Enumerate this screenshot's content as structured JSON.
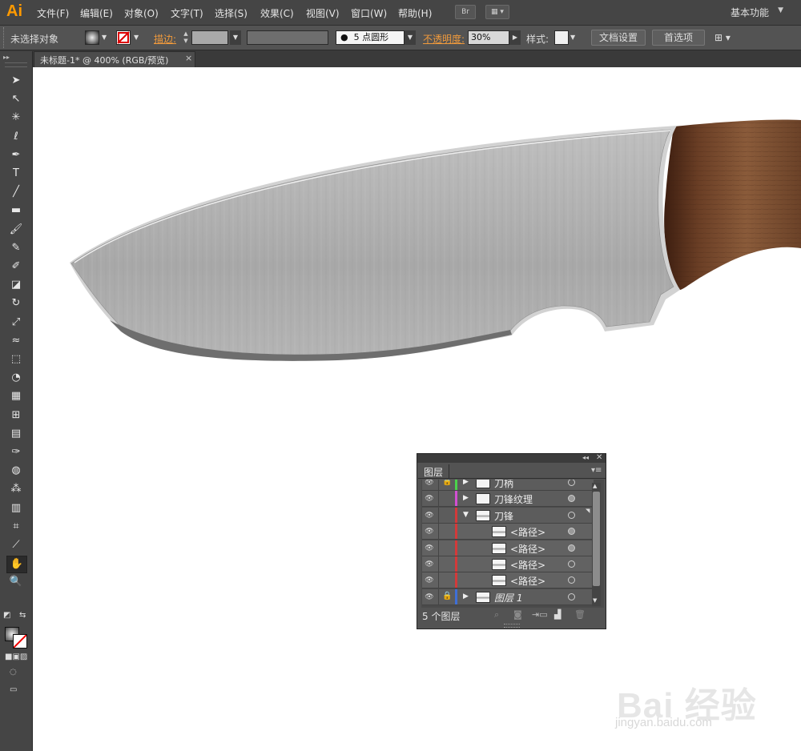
{
  "app": {
    "logo": "Ai"
  },
  "menu": {
    "items": [
      "文件(F)",
      "编辑(E)",
      "对象(O)",
      "文字(T)",
      "选择(S)",
      "效果(C)",
      "视图(V)",
      "窗口(W)",
      "帮助(H)"
    ],
    "bridge_label": "Br",
    "workspace": "基本功能"
  },
  "control": {
    "selection": "未选择对象",
    "stroke_label": "描边:",
    "brush_value": "5 点圆形",
    "opacity_label": "不透明度:",
    "opacity_value": "30%",
    "style_label": "样式:",
    "doc_setup": "文档设置",
    "preferences": "首选项"
  },
  "tab": {
    "title": "未标题-1* @ 400% (RGB/预览)",
    "close": "×"
  },
  "toolbar": {
    "tools": [
      "selection-tool",
      "direct-selection-tool",
      "magic-wand-tool",
      "lasso-tool",
      "pen-tool",
      "type-tool",
      "line-tool",
      "rectangle-tool",
      "paintbrush-tool",
      "pencil-tool",
      "blob-brush-tool",
      "eraser-tool",
      "rotate-tool",
      "scale-tool",
      "warp-tool",
      "free-transform-tool",
      "shape-builder-tool",
      "perspective-grid-tool",
      "mesh-tool",
      "gradient-tool",
      "eyedropper-tool",
      "blend-tool",
      "symbol-sprayer-tool",
      "column-graph-tool",
      "artboard-tool",
      "slice-tool",
      "hand-tool",
      "zoom-tool"
    ]
  },
  "layers": {
    "panel_title": "图层",
    "footer": "5 个图层",
    "rows": [
      {
        "name": "刀柄",
        "color": "#4bd34b",
        "expand": "▶",
        "locked": true,
        "target": "empty",
        "italic": false,
        "level": 0
      },
      {
        "name": "刀锋纹理",
        "color": "#d24fd2",
        "expand": "▶",
        "locked": false,
        "target": "filled",
        "italic": false,
        "level": 0
      },
      {
        "name": "刀锋",
        "color": "#d23a3a",
        "expand": "▼",
        "locked": false,
        "target": "empty",
        "italic": false,
        "level": 0
      },
      {
        "name": "<路径>",
        "color": "#d23a3a",
        "expand": "",
        "locked": false,
        "target": "filled",
        "italic": false,
        "level": 1
      },
      {
        "name": "<路径>",
        "color": "#d23a3a",
        "expand": "",
        "locked": false,
        "target": "filled",
        "italic": false,
        "level": 1
      },
      {
        "name": "<路径>",
        "color": "#d23a3a",
        "expand": "",
        "locked": false,
        "target": "empty",
        "italic": false,
        "level": 1
      },
      {
        "name": "<路径>",
        "color": "#d23a3a",
        "expand": "",
        "locked": false,
        "target": "empty",
        "italic": false,
        "level": 1
      },
      {
        "name": "图层 1",
        "color": "#3f6fd6",
        "expand": "▶",
        "locked": true,
        "target": "empty",
        "italic": true,
        "level": 0
      }
    ]
  },
  "watermark": {
    "brand": "Bai 经验",
    "url": "jingyan.baidu.com"
  }
}
